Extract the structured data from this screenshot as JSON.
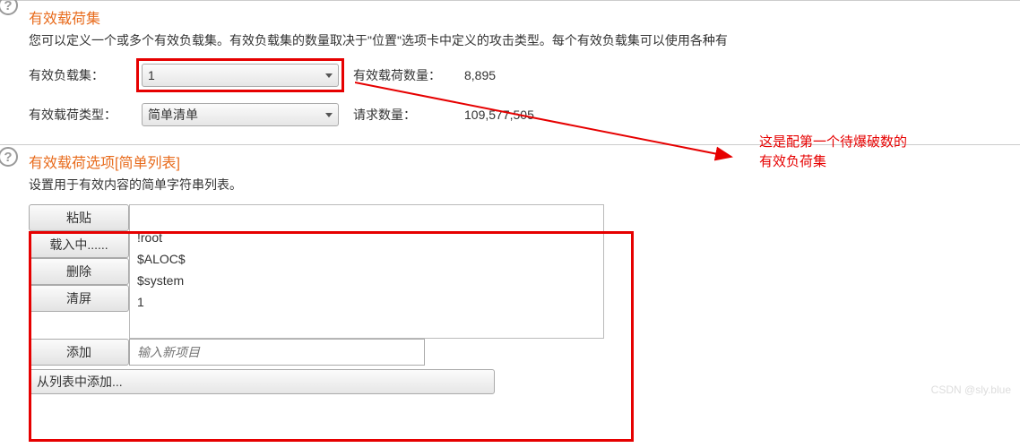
{
  "section1": {
    "title": "有效载荷集",
    "desc": "您可以定义一个或多个有效负载集。有效负载集的数量取决于\"位置\"选项卡中定义的攻击类型。每个有效负载集可以使用各种有",
    "row1": {
      "label": "有效负载集：",
      "value": "1",
      "stat_label": "有效载荷数量：",
      "stat_value": "8,895"
    },
    "row2": {
      "label": "有效载荷类型：",
      "value": "简单清单",
      "stat_label": "请求数量：",
      "stat_value": "109,577,505"
    }
  },
  "section2": {
    "title": "有效载荷选项[简单列表]",
    "desc": "设置用于有效内容的简单字符串列表。",
    "buttons": {
      "paste": "粘贴",
      "load": "载入中......",
      "delete": "删除",
      "clear": "清屏",
      "add": "添加"
    },
    "list": {
      "i0": "!root",
      "i1": "$ALOC$",
      "i2": "$system",
      "i3": "1"
    },
    "add_placeholder": "输入新项目",
    "combo": "从列表中添加..."
  },
  "annotation": {
    "line1": "这是配第一个待爆破数的",
    "line2": "有效负荷集"
  },
  "watermark": "CSDN @sly.blue"
}
